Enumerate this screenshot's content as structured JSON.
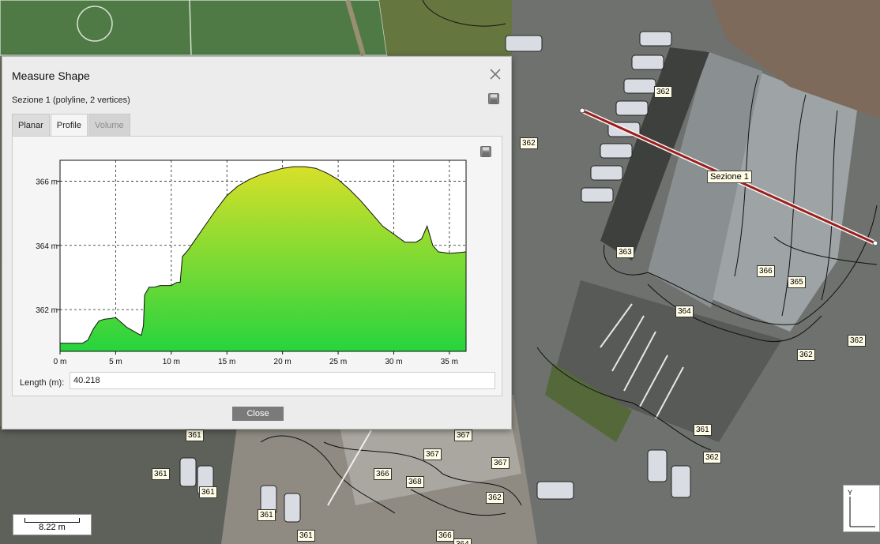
{
  "dialog": {
    "title": "Measure Shape",
    "subtitle": "Sezione 1 (polyline, 2 vertices)",
    "tabs": [
      {
        "label": "Planar",
        "state": "normal"
      },
      {
        "label": "Profile",
        "state": "active"
      },
      {
        "label": "Volume",
        "state": "disabled"
      }
    ],
    "length_label": "Length (m):",
    "length_value": "40.218",
    "close_label": "Close",
    "icons": {
      "close": "close-icon",
      "save": "save-icon"
    }
  },
  "chart_data": {
    "type": "area",
    "xlabel": "",
    "ylabel": "",
    "xlim": [
      0,
      36.5
    ],
    "ylim": [
      360.7,
      366.65
    ],
    "x_ticks": [
      0,
      5,
      10,
      15,
      20,
      25,
      30,
      35
    ],
    "x_tick_labels": [
      "0 m",
      "5 m",
      "10 m",
      "15 m",
      "20 m",
      "25 m",
      "30 m",
      "35 m"
    ],
    "y_ticks": [
      362,
      364,
      366
    ],
    "y_tick_labels": [
      "362 m",
      "364 m",
      "366 m"
    ],
    "grid": true,
    "fill_colors": {
      "top": "#d7e029",
      "bottom": "#27d43e"
    },
    "series": [
      {
        "x": [
          0,
          1,
          2,
          2.5,
          3,
          3.5,
          4,
          4.5,
          5,
          5.5,
          6,
          6.5,
          7,
          7.3,
          7.5,
          7.6,
          8,
          8.5,
          9,
          9.5,
          10,
          10.5,
          10.8,
          11,
          11.5,
          12,
          13,
          14,
          15,
          16,
          17,
          18,
          19,
          20,
          21,
          22,
          23,
          24,
          25,
          26,
          27,
          28,
          29,
          30,
          31,
          32,
          32.5,
          33,
          33.5,
          34,
          35,
          36,
          36.5
        ],
        "y": [
          360.95,
          360.95,
          360.95,
          361.05,
          361.4,
          361.65,
          361.7,
          361.72,
          361.75,
          361.6,
          361.45,
          361.35,
          361.25,
          361.2,
          361.5,
          362.45,
          362.7,
          362.7,
          362.75,
          362.75,
          362.75,
          362.85,
          362.85,
          363.65,
          363.85,
          364.1,
          364.6,
          365.1,
          365.55,
          365.85,
          366.05,
          366.2,
          366.3,
          366.4,
          366.45,
          366.45,
          366.4,
          366.25,
          366.05,
          365.75,
          365.4,
          365.0,
          364.6,
          364.35,
          364.1,
          364.1,
          364.2,
          364.6,
          364.0,
          363.8,
          363.75,
          363.78,
          363.8
        ]
      }
    ]
  },
  "map": {
    "section_label": "Sezione 1",
    "contour_labels": [
      "362",
      "362",
      "363",
      "366",
      "365",
      "364",
      "362",
      "362",
      "361",
      "362",
      "361",
      "361",
      "361",
      "367",
      "367",
      "367",
      "366",
      "368",
      "362",
      "361",
      "361",
      "366",
      "364"
    ],
    "scale_label": "8.22 m",
    "axis_label": "Y"
  }
}
